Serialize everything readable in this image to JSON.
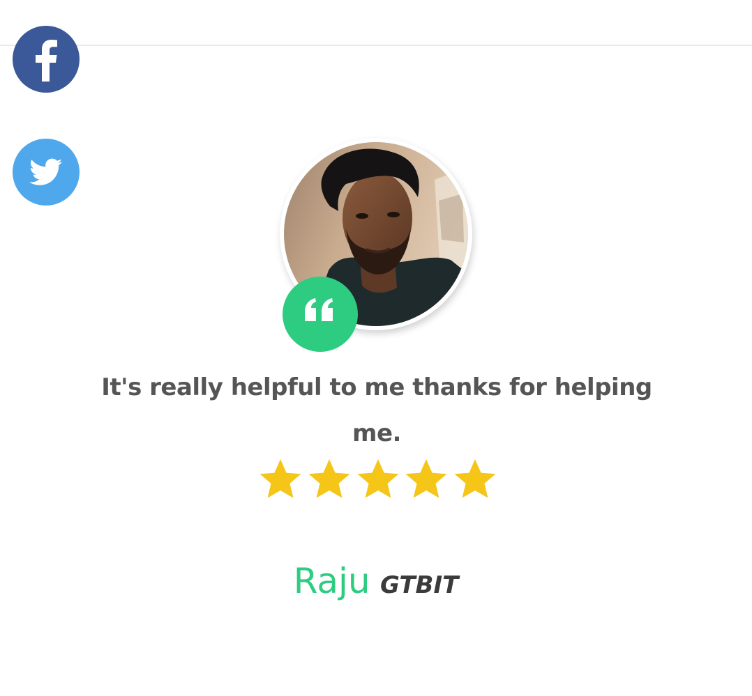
{
  "social": [
    {
      "name": "facebook",
      "icon": "facebook-icon",
      "color": "#3b5998"
    },
    {
      "name": "twitter",
      "icon": "twitter-icon",
      "color": "#4fa8ec"
    }
  ],
  "testimonial": {
    "avatar": "user-photo",
    "quote_icon": "quote-icon",
    "quote_color": "#2ecc81",
    "text": "It's really helpful to me thanks for helping me.",
    "rating": 5,
    "rating_max": 5,
    "star_color": "#f5c518",
    "author_name": "Raju",
    "author_org": "GTBIT"
  }
}
